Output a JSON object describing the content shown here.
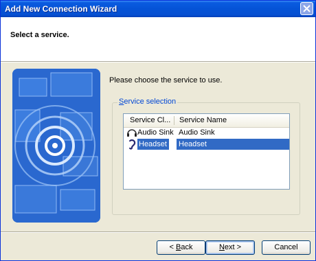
{
  "window": {
    "title": "Add New Connection Wizard"
  },
  "header": {
    "title": "Select a service."
  },
  "content": {
    "instruction": "Please choose the service to use.",
    "group_label_accel": "S",
    "group_label_rest": "ervice selection"
  },
  "list": {
    "columns": [
      "Service Cl...",
      "Service Name"
    ],
    "rows": [
      {
        "class": "Audio Sink",
        "name": "Audio Sink",
        "icon": "headphones-icon",
        "selected": false
      },
      {
        "class": "Headset",
        "name": "Headset",
        "icon": "headset-icon",
        "selected": true
      }
    ]
  },
  "buttons": {
    "back_prefix": "< ",
    "back_accel": "B",
    "back_rest": "ack",
    "next_accel": "N",
    "next_rest": "ext >",
    "cancel": "Cancel"
  },
  "colors": {
    "title_bar": "#0553d6",
    "selection": "#316ac5",
    "group_label": "#0046d5",
    "face": "#ece9d8"
  }
}
